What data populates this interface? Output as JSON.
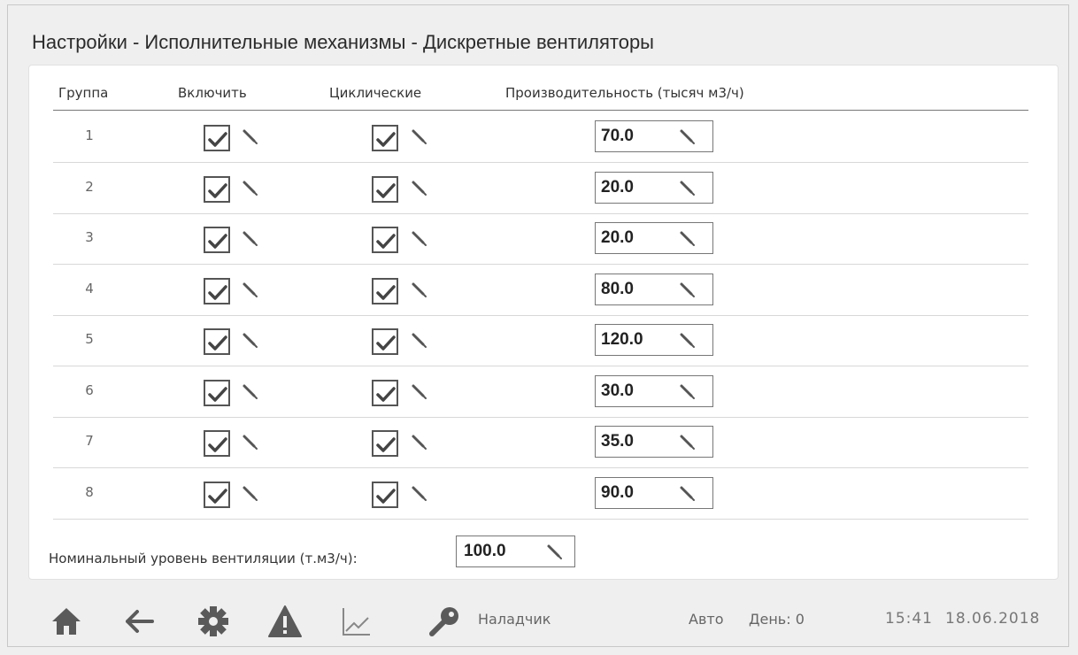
{
  "header": {
    "title": "Настройки - Исполнительные механизмы - Дискретные вентиляторы"
  },
  "table": {
    "columns": [
      "Группа",
      "Включить",
      "Циклические",
      "Производительность (тысяч м3/ч)"
    ],
    "rows": [
      {
        "group": "1",
        "enabled": true,
        "cyclic": true,
        "capacity": "70.0"
      },
      {
        "group": "2",
        "enabled": true,
        "cyclic": true,
        "capacity": "20.0"
      },
      {
        "group": "3",
        "enabled": true,
        "cyclic": true,
        "capacity": "20.0"
      },
      {
        "group": "4",
        "enabled": true,
        "cyclic": true,
        "capacity": "80.0"
      },
      {
        "group": "5",
        "enabled": true,
        "cyclic": true,
        "capacity": "120.0"
      },
      {
        "group": "6",
        "enabled": true,
        "cyclic": true,
        "capacity": "30.0"
      },
      {
        "group": "7",
        "enabled": true,
        "cyclic": true,
        "capacity": "35.0"
      },
      {
        "group": "8",
        "enabled": true,
        "cyclic": true,
        "capacity": "90.0"
      }
    ]
  },
  "nominal": {
    "label": "Номинальный уровень вентиляции (т.м3/ч):",
    "value": "100.0"
  },
  "bottombar": {
    "icons": [
      "home-icon",
      "back-arrow-icon",
      "gear-icon",
      "warning-icon",
      "chart-icon",
      "key-icon"
    ],
    "user": "Наладчик",
    "mode": "Авто",
    "day": "День: 0",
    "time": "15:41",
    "date": "18.06.2018"
  },
  "colors": {
    "background": "#efefef",
    "panel": "#ffffff",
    "icon": "#5a5a5a"
  }
}
